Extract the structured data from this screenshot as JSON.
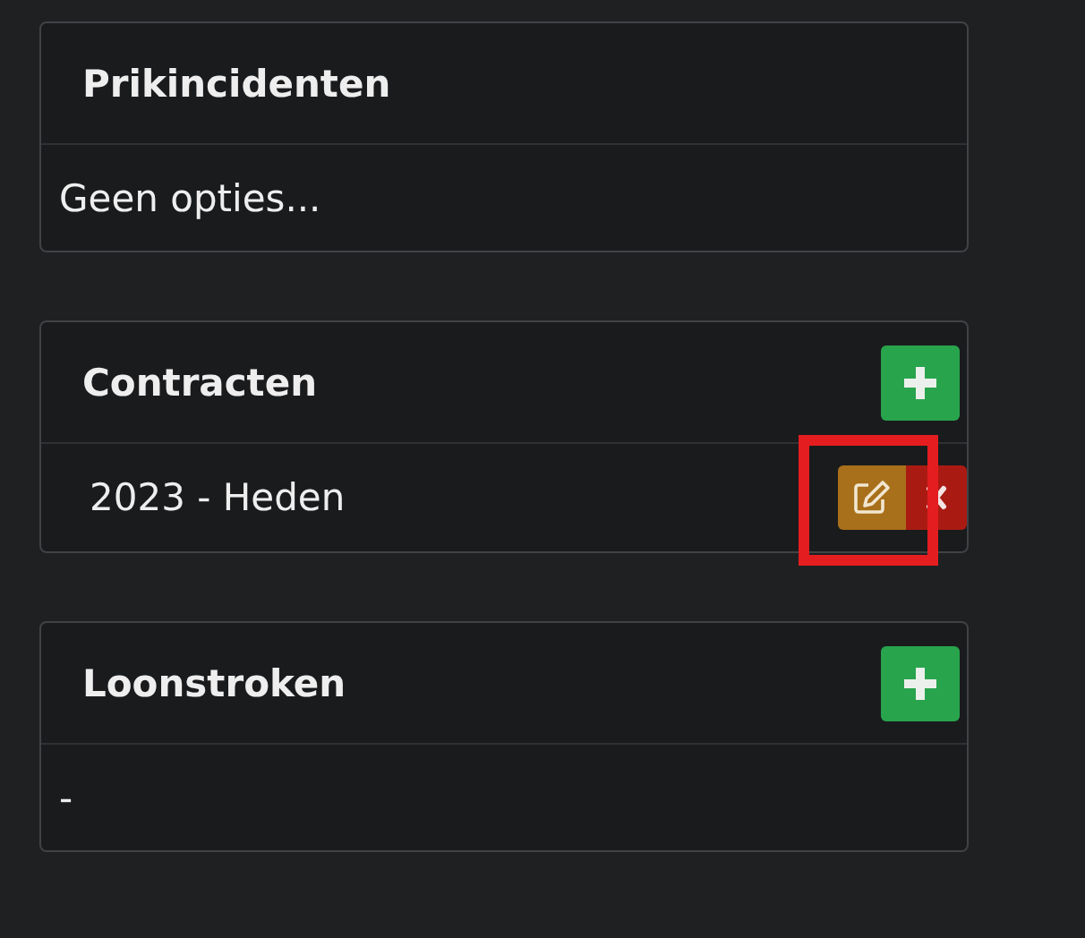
{
  "panels": [
    {
      "title": "Prikincidenten",
      "has_add": false,
      "body": {
        "kind": "text",
        "text": "Geen opties..."
      }
    },
    {
      "title": "Contracten",
      "has_add": true,
      "body": {
        "kind": "rows",
        "rows": [
          {
            "label": "2023 - Heden",
            "edit_highlighted": true
          }
        ]
      }
    },
    {
      "title": "Loonstroken",
      "has_add": true,
      "body": {
        "kind": "text",
        "text": "-"
      }
    }
  ]
}
